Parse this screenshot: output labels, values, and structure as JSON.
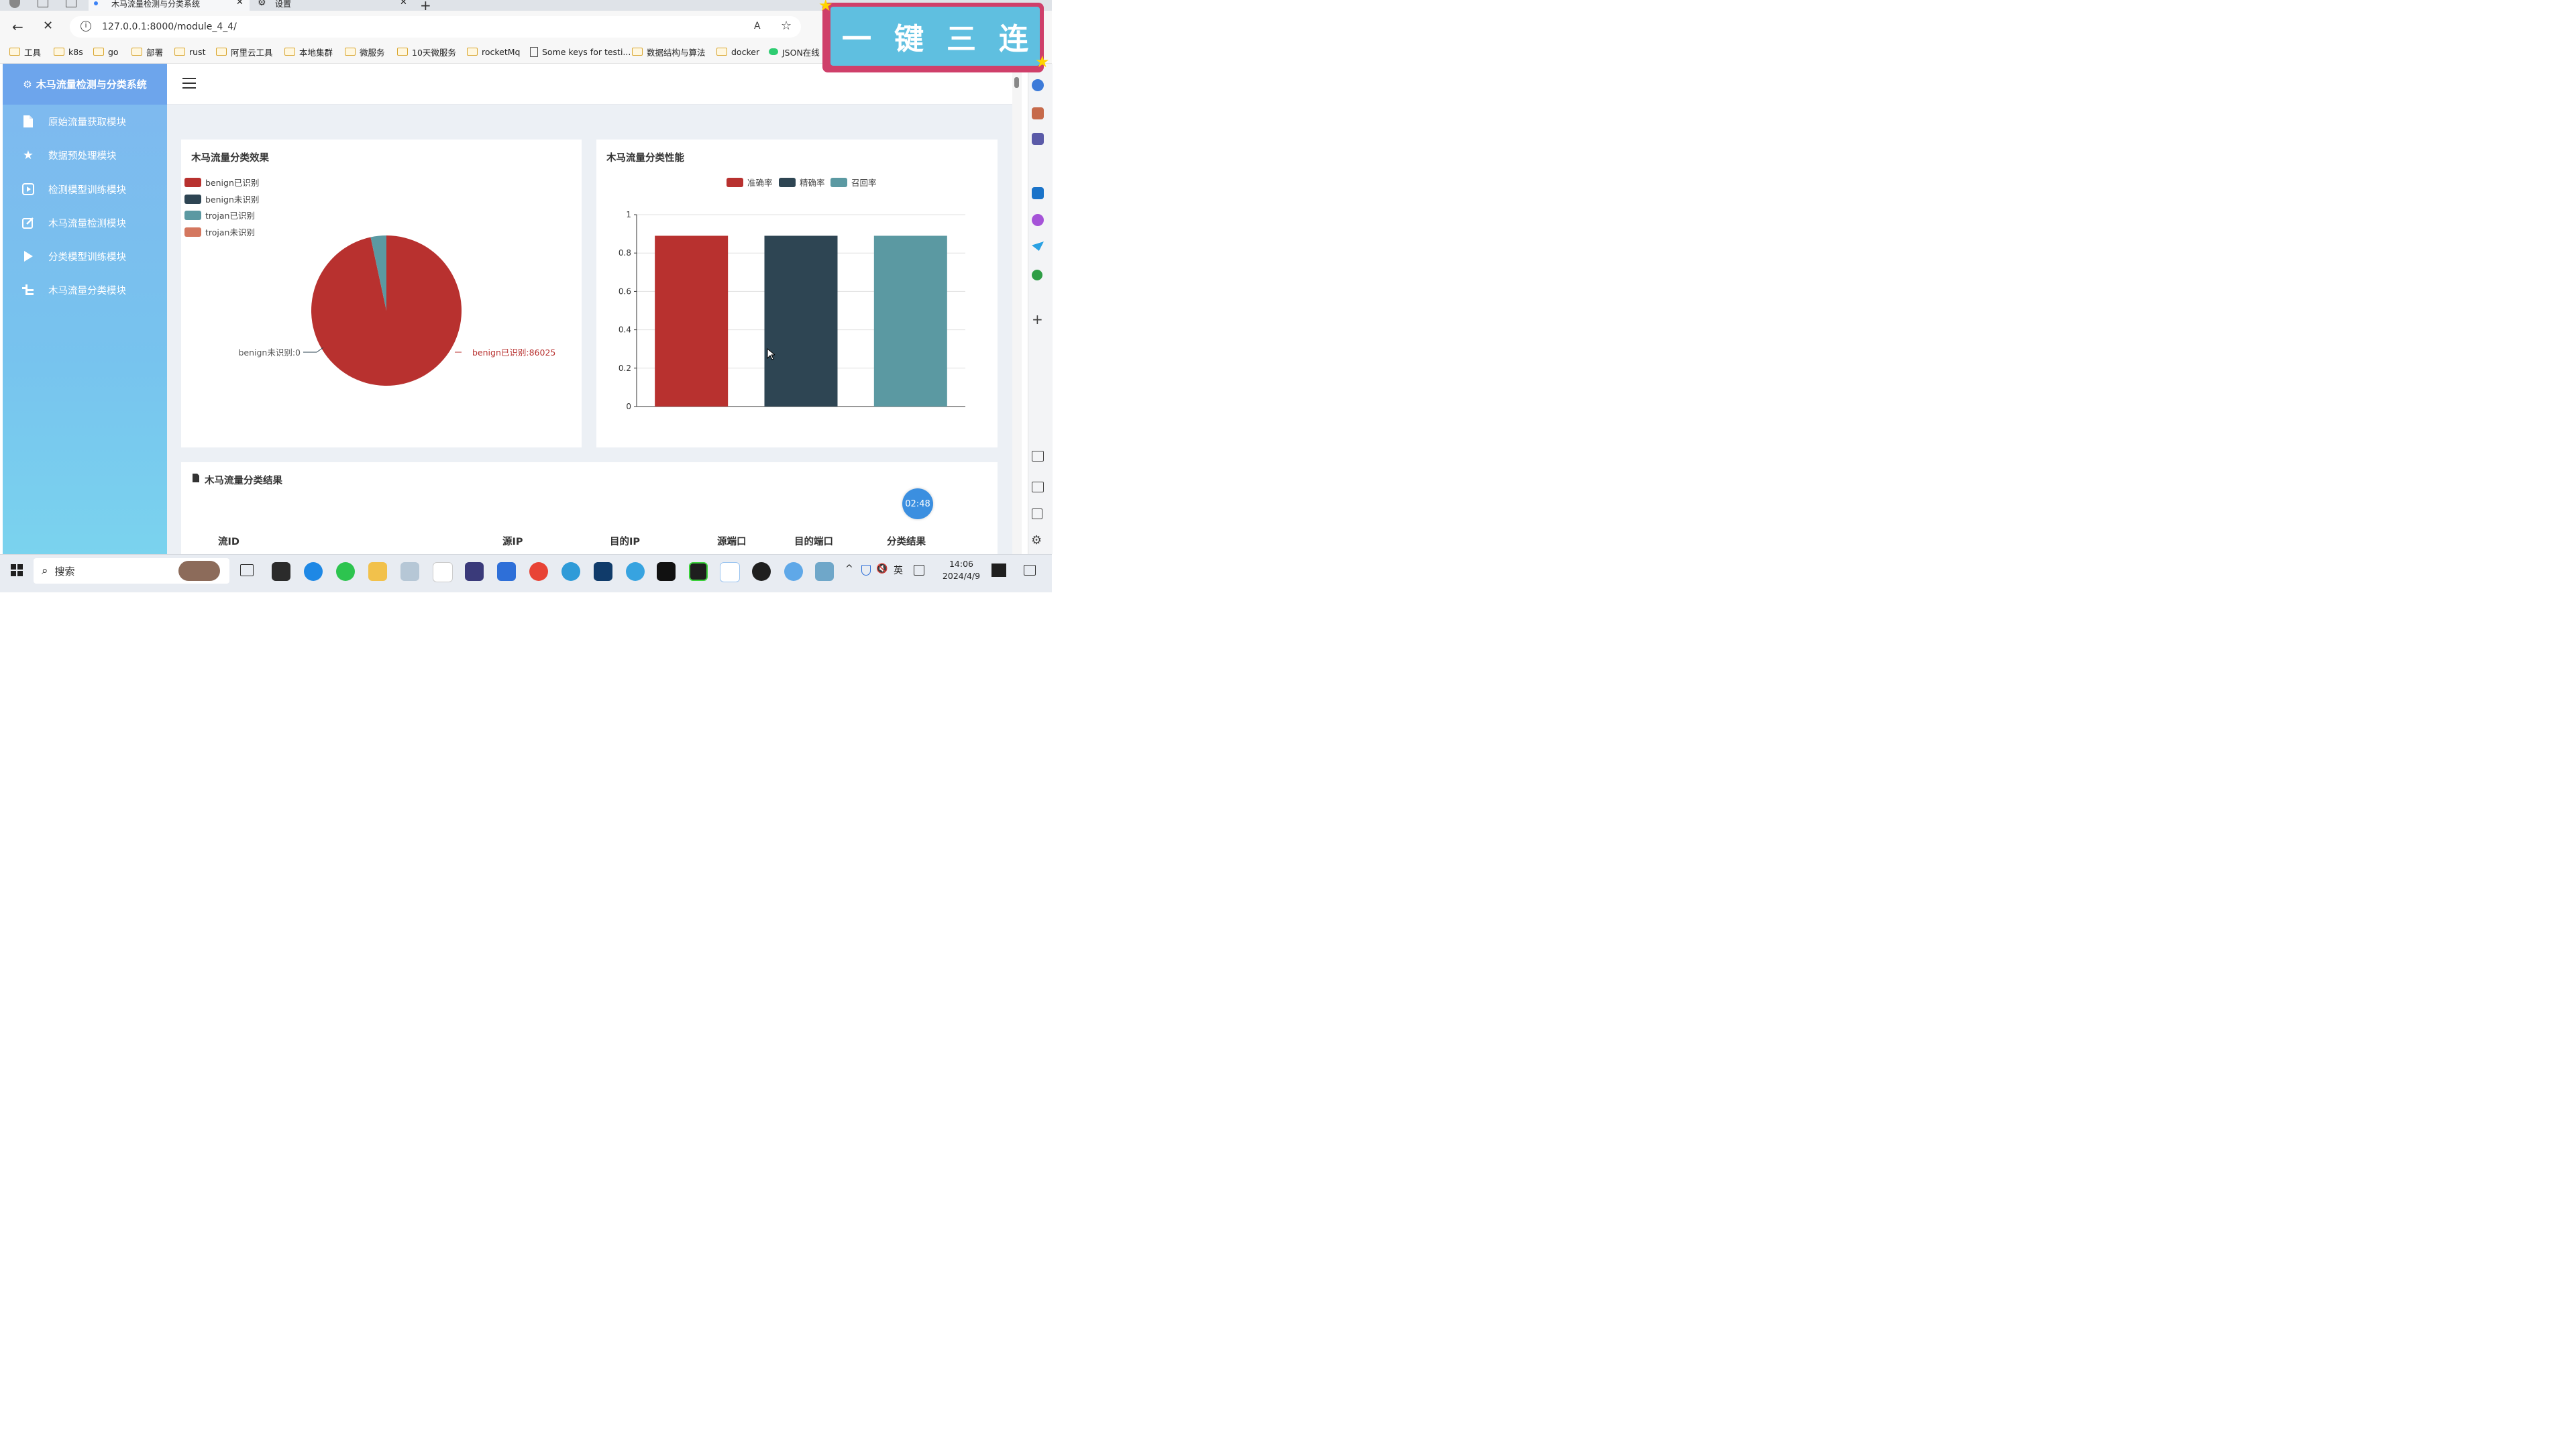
{
  "browser": {
    "tabs": [
      {
        "label": "木马流量检测与分类系统",
        "active": true
      },
      {
        "label": "设置",
        "active": false
      }
    ],
    "url": "127.0.0.1:8000/module_4_4/",
    "bookmarks": [
      "工具",
      "k8s",
      "go",
      "部署",
      "rust",
      "阿里云工具",
      "本地集群",
      "微服务",
      "10天微服务",
      "rocketMq",
      "Some keys for testi...",
      "数据结构与算法",
      "docker",
      "JSON在线"
    ]
  },
  "badge": {
    "chars": [
      "一",
      "键",
      "三",
      "连"
    ]
  },
  "sidebar": {
    "brand": "木马流量检测与分类系统",
    "items": [
      {
        "label": "原始流量获取模块",
        "icon": "file-icon"
      },
      {
        "label": "数据预处理模块",
        "icon": "star-icon"
      },
      {
        "label": "检测模型训练模块",
        "icon": "play-square-icon"
      },
      {
        "label": "木马流量检测模块",
        "icon": "edit-icon"
      },
      {
        "label": "分类模型训练模块",
        "icon": "play-icon"
      },
      {
        "label": "木马流量分类模块",
        "icon": "tree-icon"
      }
    ]
  },
  "pie_panel": {
    "title": "木马流量分类效果",
    "legend": [
      "benign已识别",
      "benign未识别",
      "trojan已识别",
      "trojan未识别"
    ],
    "labels": {
      "benign_recognized": "benign已识别:86025",
      "benign_unrecognized": "benign未识别:0"
    }
  },
  "bar_panel": {
    "title": "木马流量分类性能",
    "legend": [
      "准确率",
      "精确率",
      "召回率"
    ]
  },
  "chart_data": [
    {
      "type": "pie",
      "title": "木马流量分类效果",
      "categories": [
        "benign已识别",
        "benign未识别",
        "trojan已识别",
        "trojan未识别"
      ],
      "values": [
        86025,
        0,
        3000,
        0
      ],
      "colors": [
        "#b8312f",
        "#2e4553",
        "#5b99a2",
        "#d4775f"
      ]
    },
    {
      "type": "bar",
      "title": "木马流量分类性能",
      "categories": [
        "准确率",
        "精确率",
        "召回率"
      ],
      "values": [
        0.89,
        0.89,
        0.89
      ],
      "colors": [
        "#b8312f",
        "#2e4553",
        "#5b99a2"
      ],
      "ylim": [
        0,
        1
      ],
      "yticks": [
        "0",
        "0.2",
        "0.4",
        "0.6",
        "0.8",
        "1"
      ],
      "grid": true,
      "legend_position": "top"
    }
  ],
  "table": {
    "title": "木马流量分类结果",
    "headers": [
      "流ID",
      "源IP",
      "目的IP",
      "源端口",
      "目的端口",
      "分类结果"
    ]
  },
  "timer": "02:48",
  "taskbar": {
    "search_placeholder": "搜索",
    "time": "14:06",
    "date": "2024/4/9",
    "lang": "英"
  }
}
